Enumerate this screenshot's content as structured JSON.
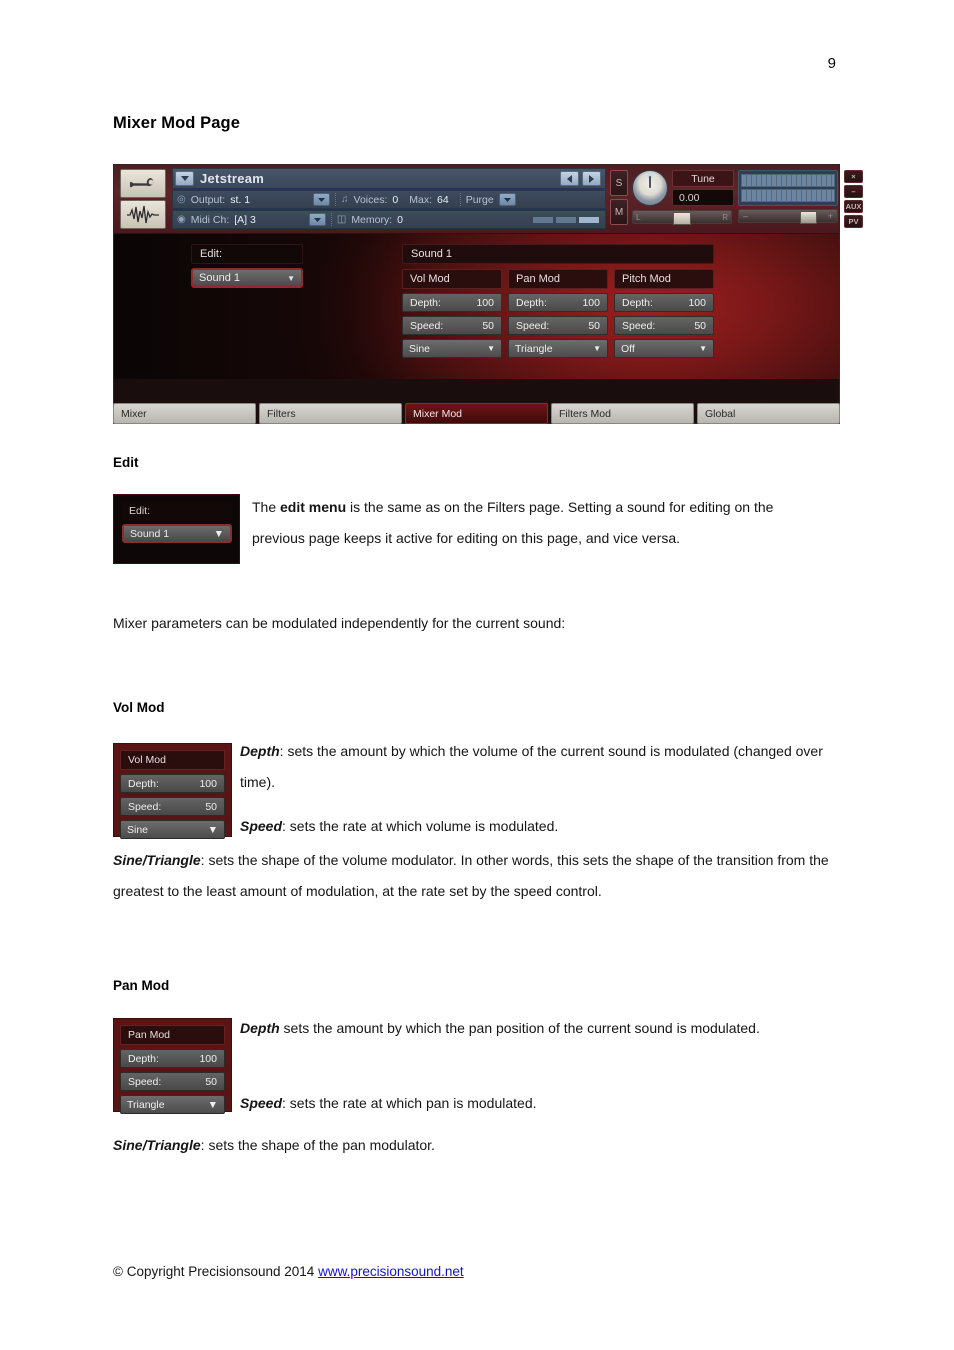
{
  "document": {
    "page_number": "9",
    "title": "Mixer Mod Page",
    "intro_line": "Mixer parameters can be modulated independently for the current sound:",
    "footer": {
      "copyright": "© Copyright Precisionsound 2014 ",
      "link": "www.precisionsound.net"
    }
  },
  "kontakt": {
    "instrument_name": "Jetstream",
    "icons": {
      "wrench": "wrench-icon",
      "waveform": "waveform-icon"
    },
    "info": {
      "output_label": "Output:",
      "output_value": "st. 1",
      "midi_label": "Midi Ch:",
      "midi_value": "[A] 3",
      "voices_label": "Voices:",
      "voices_value": "0",
      "max_label": "Max:",
      "max_value": "64",
      "purge_label": "Purge",
      "memory_label": "Memory:",
      "memory_value": "0"
    },
    "solo_label": "S",
    "mute_label": "M",
    "tune_label": "Tune",
    "tune_value": "0.00",
    "pan_left": "L",
    "pan_right": "R",
    "vol_minus": "–",
    "vol_plus": "+",
    "corner_buttons": [
      "×",
      "–",
      "AUX",
      "PV"
    ],
    "panel": {
      "edit_label": "Edit:",
      "edit_value": "Sound 1",
      "sound_bar": "Sound 1",
      "mods": [
        {
          "title": "Vol Mod",
          "depth_label": "Depth:",
          "depth_value": "100",
          "speed_label": "Speed:",
          "speed_value": "50",
          "shape": "Sine"
        },
        {
          "title": "Pan Mod",
          "depth_label": "Depth:",
          "depth_value": "100",
          "speed_label": "Speed:",
          "speed_value": "50",
          "shape": "Triangle"
        },
        {
          "title": "Pitch Mod",
          "depth_label": "Depth:",
          "depth_value": "100",
          "speed_label": "Speed:",
          "speed_value": "50",
          "shape": "Off"
        }
      ]
    },
    "tabs": [
      {
        "label": "Mixer",
        "active": false
      },
      {
        "label": "Filters",
        "active": false
      },
      {
        "label": "Mixer Mod",
        "active": true
      },
      {
        "label": "Filters Mod",
        "active": false
      },
      {
        "label": "Global",
        "active": false
      }
    ]
  },
  "sections": {
    "edit": {
      "heading": "Edit",
      "widget": {
        "label": "Edit:",
        "value": "Sound 1"
      },
      "body_lead": "The ",
      "body_bold": "edit menu",
      "body_rest": " is the same as on the Filters page. Setting a sound for editing on the previous page keeps it active for editing on this page, and vice versa."
    },
    "vol_mod": {
      "heading": "Vol Mod",
      "widget": {
        "title": "Vol Mod",
        "depth_label": "Depth:",
        "depth_value": "100",
        "speed_label": "Speed:",
        "speed_value": "50",
        "shape": "Sine"
      },
      "depth_term": "Depth",
      "depth_text": ": sets the amount by which the volume of the current sound is modulated (changed over time).",
      "speed_term": "Speed",
      "speed_text": ": sets the rate at which volume is modulated.",
      "shape_term": "Sine/Triangle",
      "shape_text": ": sets the shape of the volume modulator. In other words, this sets the shape of the transition from the greatest to the least amount of modulation, at the rate set by the speed control."
    },
    "pan_mod": {
      "heading": "Pan Mod",
      "widget": {
        "title": "Pan Mod",
        "depth_label": "Depth:",
        "depth_value": "100",
        "speed_label": "Speed:",
        "speed_value": "50",
        "shape": "Triangle"
      },
      "depth_term": "Depth",
      "depth_text": " sets the amount by which the pan position of the current sound is modulated.",
      "speed_term": "Speed",
      "speed_text": ": sets the rate at which pan is modulated.",
      "shape_term": "Sine/Triangle",
      "shape_text": ": sets the shape of the pan modulator."
    }
  }
}
